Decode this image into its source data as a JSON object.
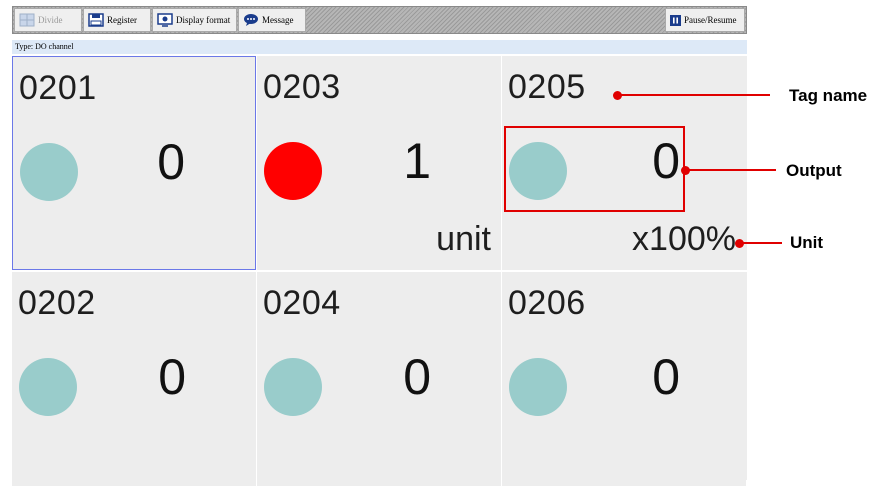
{
  "toolbar": {
    "divide_label": "Divide",
    "register_label": "Register",
    "display_format_label": "Display format",
    "message_label": "Message",
    "pause_resume_label": "Pause/Resume"
  },
  "type_label": "Type: DO channel",
  "cells": [
    {
      "tag": "0201",
      "value": "0",
      "unit": "",
      "state": "off"
    },
    {
      "tag": "0203",
      "value": "1",
      "unit": "unit",
      "state": "on"
    },
    {
      "tag": "0205",
      "value": "0",
      "unit": "x100%",
      "state": "off"
    },
    {
      "tag": "0202",
      "value": "0",
      "unit": "",
      "state": "off"
    },
    {
      "tag": "0204",
      "value": "0",
      "unit": "",
      "state": "off"
    },
    {
      "tag": "0206",
      "value": "0",
      "unit": "",
      "state": "off"
    }
  ],
  "colors": {
    "off": "#99cccb",
    "on": "#ff0000",
    "annotation": "#e00000"
  },
  "annotations": {
    "tag_name": "Tag name",
    "output": "Output",
    "unit": "Unit"
  }
}
